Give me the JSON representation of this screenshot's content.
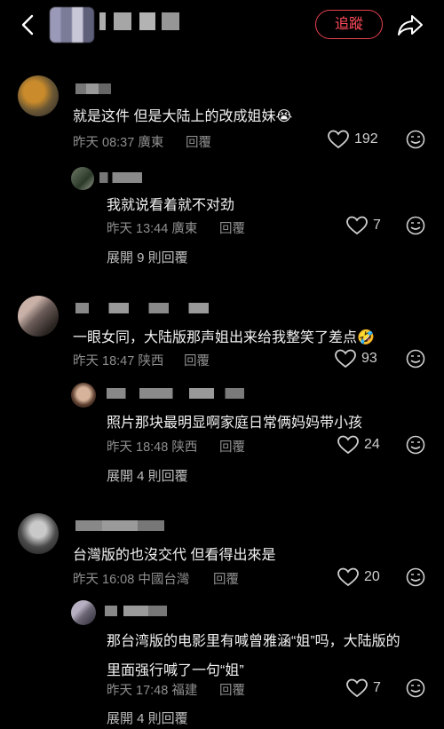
{
  "header": {
    "follow_label": "追蹤"
  },
  "threads": [
    {
      "comment": {
        "text": "就是这件 但是大陆上的改成姐妹",
        "emoji": "😭",
        "date": "昨天 08:37",
        "region": "廣東",
        "reply": "回覆",
        "likes": "192"
      },
      "reply": {
        "text": "我就说看着就不对劲",
        "date": "昨天 13:44",
        "region": "廣東",
        "reply": "回覆",
        "likes": "7"
      },
      "expand": "展開 9 則回覆"
    },
    {
      "comment": {
        "text": "一眼女同，大陆版那声姐出来给我整笑了差点",
        "emoji": "🤣",
        "date": "昨天 18:47",
        "region": "陕西",
        "reply": "回覆",
        "likes": "93"
      },
      "reply": {
        "text": "照片那块最明显啊家庭日常俩妈妈带小孩",
        "date": "昨天 18:48",
        "region": "陕西",
        "reply": "回覆",
        "likes": "24"
      },
      "expand": "展開 4 則回覆"
    },
    {
      "comment": {
        "text": "台灣版的也沒交代 但看得出來是",
        "emoji": "",
        "date": "昨天 16:08",
        "region": "中國台灣",
        "reply": "回覆",
        "likes": "20"
      },
      "reply": {
        "text_line1": "那台湾版的电影里有喊曾雅涵“姐”吗，大陆版的",
        "text_line2": "里面强行喊了一句“姐”",
        "date": "昨天 17:48",
        "region": "福建",
        "reply": "回覆",
        "likes": "7"
      },
      "expand": "展開 4 則回覆"
    }
  ]
}
